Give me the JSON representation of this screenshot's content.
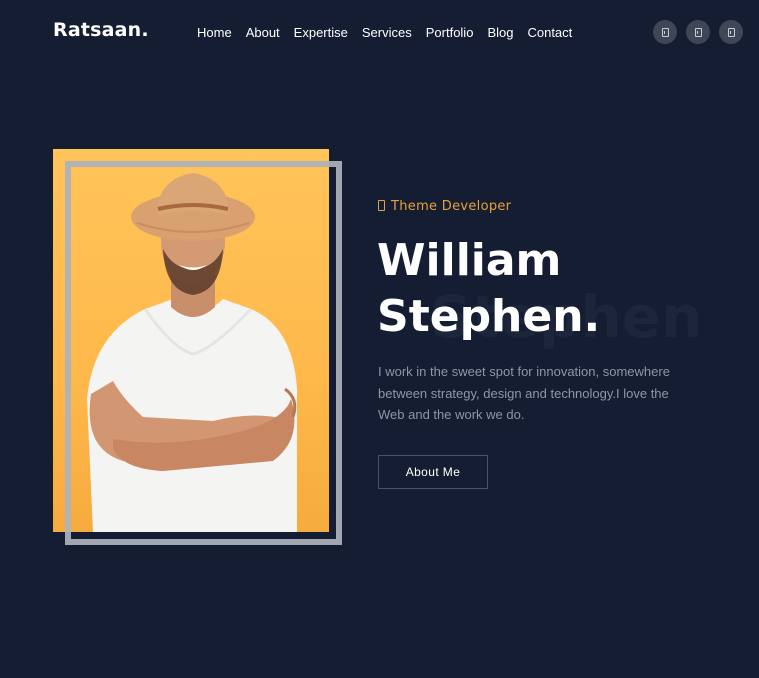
{
  "header": {
    "logo": "Ratsaan.",
    "nav": [
      "Home",
      "About",
      "Expertise",
      "Services",
      "Portfolio",
      "Blog",
      "Contact"
    ],
    "socials": [
      {
        "icon": "social-icon-1"
      },
      {
        "icon": "social-icon-2"
      },
      {
        "icon": "social-icon-3"
      }
    ]
  },
  "hero": {
    "role": "Theme Developer",
    "name_line1": "William",
    "name_line2": "Stephen.",
    "ghost_text": "Stephen",
    "bio": "I work in the sweet spot for innovation, somewhere between strategy, design and technology.I love the Web and the work we do.",
    "cta_label": "About Me"
  },
  "colors": {
    "background": "#141d31",
    "accent": "#e8a13b",
    "photo_bg": "#ffbf52",
    "frame": "#aeb2bc",
    "muted_text": "#8f96a5"
  }
}
